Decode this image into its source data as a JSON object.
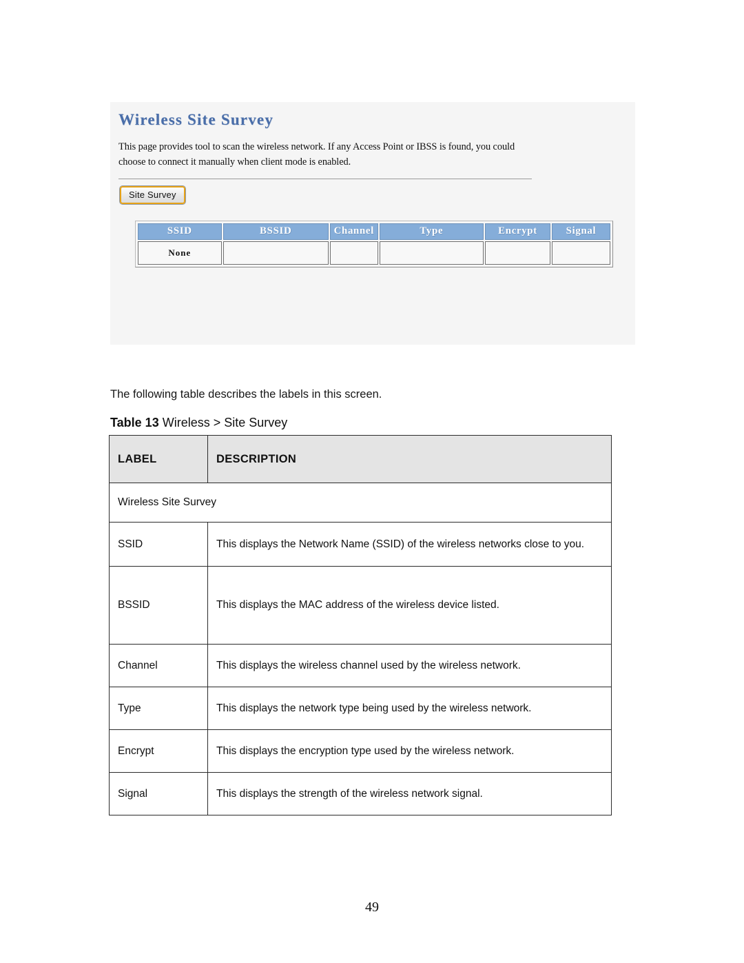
{
  "screenshot": {
    "title": "Wireless Site Survey",
    "description": "This page provides tool to scan the wireless network. If any Access Point or IBSS is found, you could choose to connect it manually when client mode is enabled.",
    "button_label": "Site Survey",
    "results_table": {
      "headers": [
        "SSID",
        "BSSID",
        "Channel",
        "Type",
        "Encrypt",
        "Signal"
      ],
      "rows": [
        [
          "None",
          "",
          "",
          "",
          "",
          ""
        ]
      ]
    },
    "colors": {
      "title": "#4a6ea9",
      "header_blue": "#85add9",
      "button_border": "#e8a317",
      "panel_background": "#f5f5f5"
    }
  },
  "document": {
    "intro": "The following table describes the labels in this screen.",
    "table_caption_prefix": "Table 13",
    "table_caption_text": "Wireless  > Site Survey",
    "table": {
      "headers": [
        "LABEL",
        "DESCRIPTION"
      ],
      "rows": [
        {
          "label": "Wireless Site Survey",
          "description": "",
          "full_span": true
        },
        {
          "label": "SSID",
          "description": "This displays the Network Name (SSID) of the wireless networks close to you."
        },
        {
          "label": "BSSID",
          "description": "This displays the MAC address of the wireless device listed."
        },
        {
          "label": "Channel",
          "description": "This displays the wireless channel used by the wireless network."
        },
        {
          "label": "Type",
          "description": "This displays the network type being used by the wireless network."
        },
        {
          "label": "Encrypt",
          "description": "This displays the encryption type used by the wireless network."
        },
        {
          "label": "Signal",
          "description": "This displays the strength of the wireless network signal."
        }
      ]
    }
  },
  "page_number": "49"
}
